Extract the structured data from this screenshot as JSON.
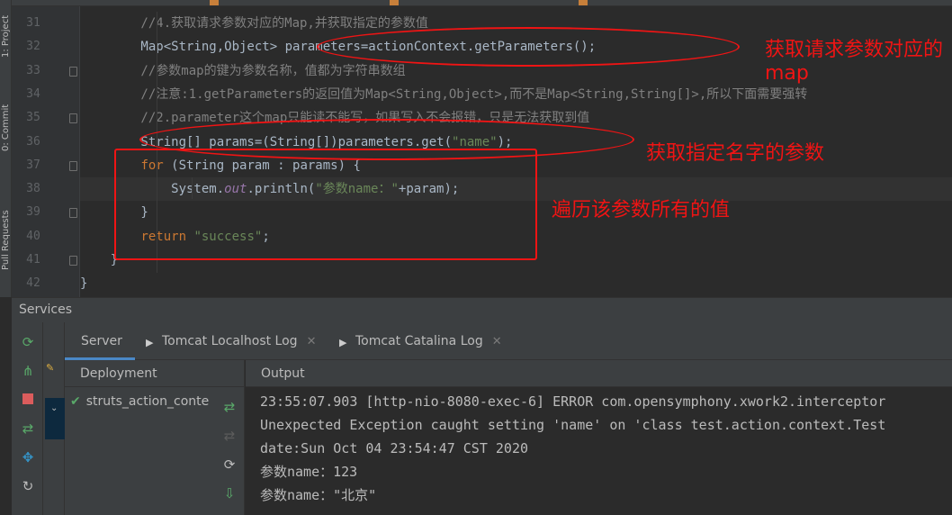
{
  "left_strip": {
    "project_tab": "1: Project",
    "commit_tab": "0: Commit",
    "pull_requests_tab": "Pull Requests"
  },
  "editor": {
    "lines": [
      {
        "num": "31",
        "parts": [
          {
            "t": "        //4.获取请求参数对应的Map,并获取指定的参数值",
            "c": "comment"
          }
        ]
      },
      {
        "num": "32",
        "parts": [
          {
            "t": "        Map<String,Object> parameters=actionContext.getParameters();",
            "c": "plain"
          }
        ]
      },
      {
        "num": "33",
        "parts": [
          {
            "t": "        //参数map的键为参数名称，值都为字符串数组",
            "c": "comment"
          }
        ]
      },
      {
        "num": "34",
        "parts": [
          {
            "t": "        //注意:1.getParameters的返回值为Map<String,Object>,而不是Map<String,String[]>,所以下面需要强转",
            "c": "comment"
          }
        ]
      },
      {
        "num": "35",
        "parts": [
          {
            "t": "        //2.parameter这个map只能读不能写，如果写入不会报错，只是无法获取到值",
            "c": "comment"
          }
        ]
      },
      {
        "num": "36",
        "parts": [
          {
            "t": "        String[] params=(String[])parameters.get(",
            "c": "plain"
          },
          {
            "t": "\"name\"",
            "c": "str"
          },
          {
            "t": ");",
            "c": "plain"
          }
        ]
      },
      {
        "num": "37",
        "parts": [
          {
            "t": "        ",
            "c": "plain"
          },
          {
            "t": "for",
            "c": "kw"
          },
          {
            "t": " (String param : params) {",
            "c": "plain"
          }
        ]
      },
      {
        "num": "38",
        "parts": [
          {
            "t": "            System.",
            "c": "plain"
          },
          {
            "t": "out",
            "c": "field"
          },
          {
            "t": ".println(",
            "c": "plain"
          },
          {
            "t": "\"参数name：\"",
            "c": "str"
          },
          {
            "t": "+param);",
            "c": "plain"
          }
        ]
      },
      {
        "num": "39",
        "parts": [
          {
            "t": "        }",
            "c": "plain"
          }
        ]
      },
      {
        "num": "40",
        "parts": [
          {
            "t": "        ",
            "c": "plain"
          },
          {
            "t": "return",
            "c": "kw"
          },
          {
            "t": " ",
            "c": "plain"
          },
          {
            "t": "\"success\"",
            "c": "str"
          },
          {
            "t": ";",
            "c": "plain"
          }
        ]
      },
      {
        "num": "41",
        "parts": [
          {
            "t": "    }",
            "c": "plain"
          }
        ]
      },
      {
        "num": "42",
        "parts": [
          {
            "t": "}",
            "c": "plain"
          }
        ]
      }
    ]
  },
  "annotations": {
    "a1": "获取请求参数对应的map",
    "a2": "获取指定名字的参数",
    "a3": "遍历该参数所有的值"
  },
  "services": {
    "title": "Services",
    "tabs": [
      {
        "label": "Server"
      },
      {
        "label": "Tomcat Localhost Log"
      },
      {
        "label": "Tomcat Catalina Log"
      }
    ],
    "deployment_header": "Deployment",
    "deployment_item": "struts_action_conte",
    "output_header": "Output",
    "output_lines": [
      "23:55:07.903 [http-nio-8080-exec-6] ERROR com.opensymphony.xwork2.interceptor",
      "Unexpected Exception caught setting 'name' on 'class test.action.context.Test",
      "date:Sun Oct 04 23:54:47 CST 2020",
      "参数name：123",
      "参数name：\"北京\""
    ]
  },
  "colors": {
    "background": "#2b2b2b",
    "annotation": "#f01414",
    "keyword": "#cc7832",
    "string": "#6a8759",
    "comment": "#808080",
    "active_tab": "#4a88c7",
    "ok_check": "#59a869"
  }
}
